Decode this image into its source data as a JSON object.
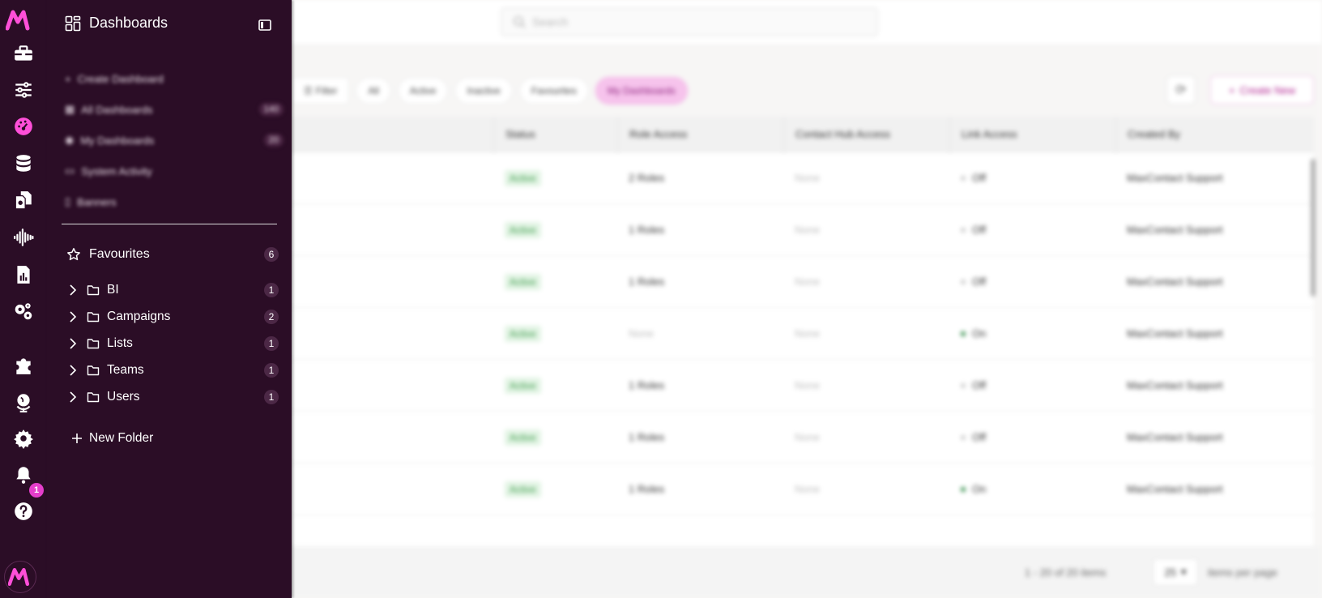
{
  "background": {
    "search_placeholder": "Search",
    "filters": [
      "Filter",
      "All",
      "Active",
      "Inactive",
      "Favourites",
      "My Dashboards"
    ],
    "active_filter": "My Dashboards",
    "create_new_label": "Create New",
    "columns": [
      "",
      "Status",
      "Role Access",
      "Contact Hub Access",
      "Link Access",
      "Created By"
    ],
    "rows": [
      {
        "status": "Active",
        "role_access": "2 Roles",
        "hub_access": "None",
        "link_access": "Off",
        "created_by": "MaxContact Support"
      },
      {
        "status": "Active",
        "role_access": "1 Roles",
        "hub_access": "None",
        "link_access": "Off",
        "created_by": "MaxContact Support"
      },
      {
        "status": "Active",
        "role_access": "1 Roles",
        "hub_access": "None",
        "link_access": "Off",
        "created_by": "MaxContact Support"
      },
      {
        "status": "Active",
        "role_access": "None",
        "hub_access": "None",
        "link_access": "On",
        "created_by": "MaxContact Support"
      },
      {
        "status": "Active",
        "role_access": "1 Roles",
        "hub_access": "None",
        "link_access": "Off",
        "created_by": "MaxContact Support"
      },
      {
        "status": "Active",
        "role_access": "1 Roles",
        "hub_access": "None",
        "link_access": "Off",
        "created_by": "MaxContact Support"
      },
      {
        "status": "Active",
        "role_access": "1 Roles",
        "hub_access": "None",
        "link_access": "On",
        "created_by": "MaxContact Support"
      }
    ],
    "pager": {
      "range_text": "1 - 20 of 20 items",
      "per_page": "25",
      "per_page_label": "items per page"
    }
  },
  "rail": {
    "notification_count": "1",
    "icons": [
      "toolbox-icon",
      "sliders-icon",
      "dashboard-gauge-icon",
      "database-icon",
      "documents-icon",
      "audio-waveform-icon",
      "report-icon",
      "cogs-icon",
      "puzzle-icon",
      "globe-icon",
      "settings-icon",
      "bell-icon",
      "help-icon"
    ],
    "active_icon": "dashboard-gauge-icon",
    "accent_color": "#ff4fd8"
  },
  "panel": {
    "title": "Dashboards",
    "menu": [
      {
        "label": "Create Dashboard",
        "count": ""
      },
      {
        "label": "All Dashboards",
        "count": "140"
      },
      {
        "label": "My Dashboards",
        "count": "20"
      },
      {
        "label": "System Activity",
        "count": ""
      },
      {
        "label": "Banners",
        "count": ""
      }
    ],
    "favourites": {
      "label": "Favourites",
      "count": "6"
    },
    "folders": [
      {
        "label": "BI",
        "count": "1"
      },
      {
        "label": "Campaigns",
        "count": "2"
      },
      {
        "label": "Lists",
        "count": "1"
      },
      {
        "label": "Teams",
        "count": "1"
      },
      {
        "label": "Users",
        "count": "1"
      }
    ],
    "new_folder_label": "New Folder",
    "background_color": "#2b0d26"
  }
}
